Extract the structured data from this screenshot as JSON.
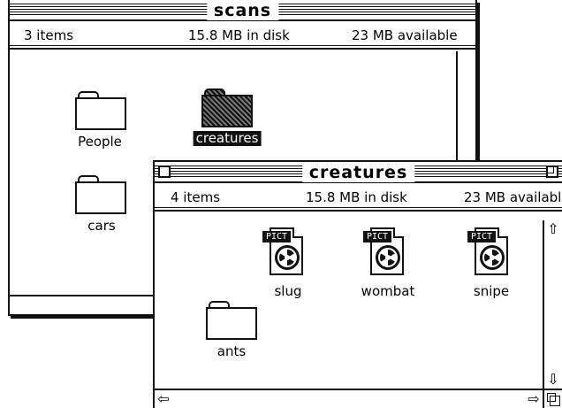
{
  "back_window": {
    "title": "scans",
    "info": {
      "items": "3 items",
      "disk": "15.8 MB in disk",
      "available": "23 MB available"
    },
    "icons": [
      {
        "label": "People",
        "kind": "folder-icon"
      },
      {
        "label": "creatures",
        "kind": "folder-icon",
        "selected": true
      },
      {
        "label": "cars",
        "kind": "folder-icon"
      }
    ]
  },
  "front_window": {
    "title": "creatures",
    "info": {
      "items": "4 items",
      "disk": "15.8 MB in disk",
      "available": "23 MB availabl"
    },
    "icons": [
      {
        "label": "slug",
        "kind": "pict-file-icon",
        "badge": "PICT"
      },
      {
        "label": "wombat",
        "kind": "pict-file-icon",
        "badge": "PICT"
      },
      {
        "label": "snipe",
        "kind": "pict-file-icon",
        "badge": "PICT"
      },
      {
        "label": "ants",
        "kind": "folder-icon"
      }
    ],
    "scroll_icons": {
      "up": "up-arrow-icon",
      "down": "down-arrow-icon",
      "left": "left-arrow-icon",
      "right": "right-arrow-icon"
    }
  }
}
